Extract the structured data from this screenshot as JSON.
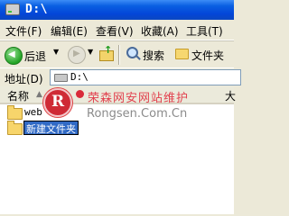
{
  "window": {
    "title": "D:\\"
  },
  "menu": [
    {
      "label": "文件(F)"
    },
    {
      "label": "编辑(E)"
    },
    {
      "label": "查看(V)"
    },
    {
      "label": "收藏(A)"
    },
    {
      "label": "工具(T)"
    }
  ],
  "toolbar": {
    "back_label": "后退",
    "search_label": "搜索",
    "folders_label": "文件夹"
  },
  "address": {
    "label": "地址(D)",
    "value": "D:\\"
  },
  "columns": {
    "name": "名称",
    "type": "大"
  },
  "files": [
    {
      "name": "web"
    },
    {
      "name": "新建文件夹",
      "renaming": true
    }
  ],
  "watermark": {
    "cn": "荣森网安网站维护",
    "en": "Rongsen.Com.Cn"
  },
  "colors": {
    "title_bar": "#0a5fe2",
    "selection": "#316ac5",
    "watermark_red": "#cf2a35"
  }
}
